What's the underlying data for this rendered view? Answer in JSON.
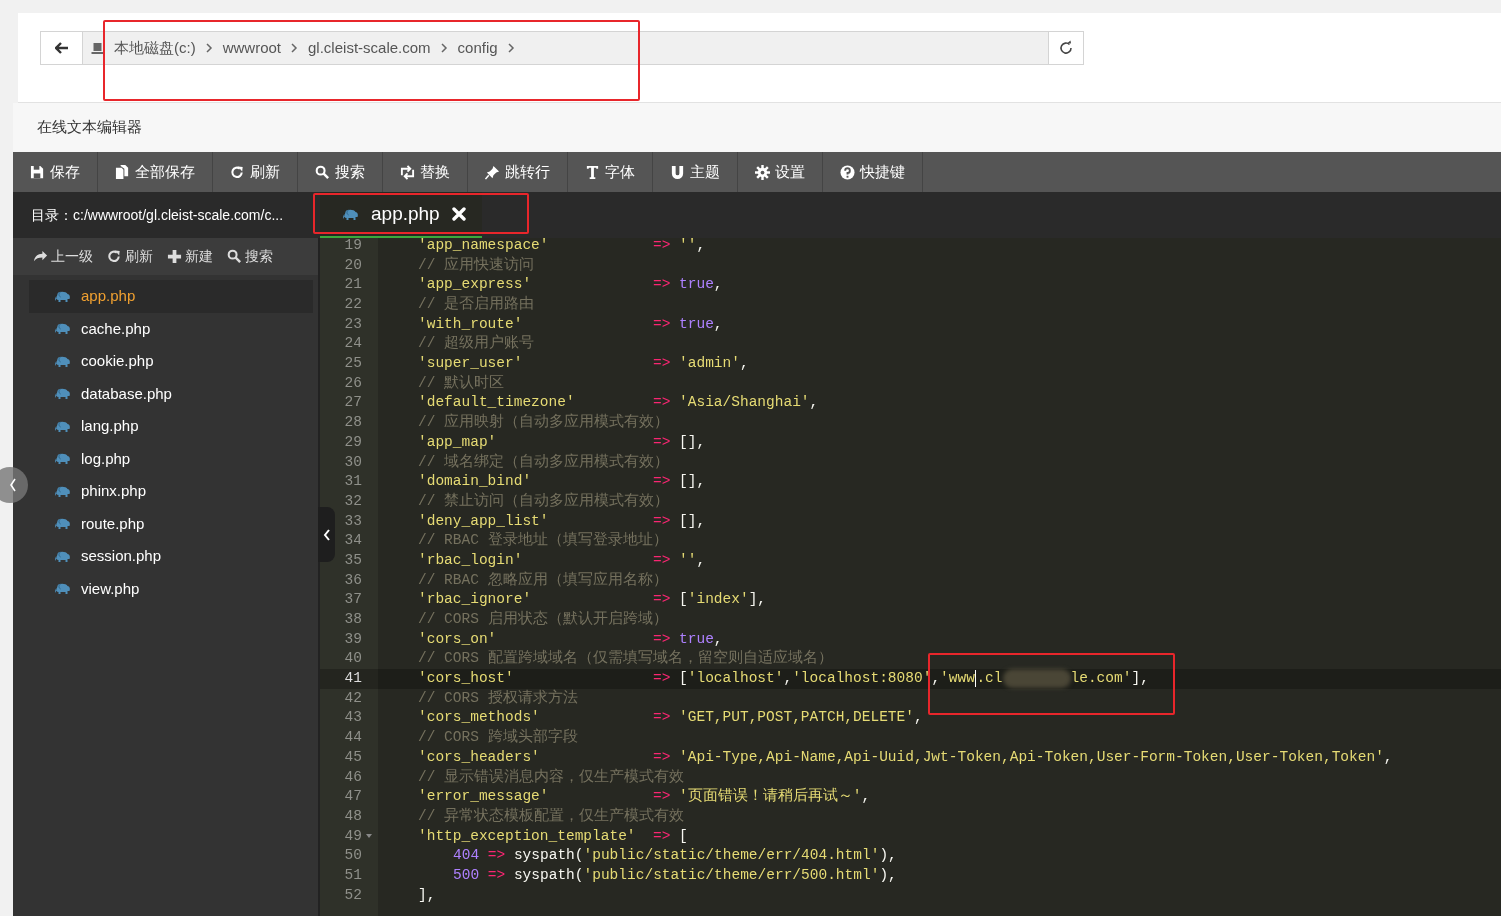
{
  "address_bar": {
    "crumbs": [
      "本地磁盘(c:)",
      "wwwroot",
      "gl.cleist-scale.com",
      "config"
    ]
  },
  "editor": {
    "title": "在线文本编辑器",
    "toolbar": [
      {
        "kind": "save",
        "label": "保存"
      },
      {
        "kind": "save-all",
        "label": "全部保存"
      },
      {
        "kind": "refresh",
        "label": "刷新"
      },
      {
        "kind": "search",
        "label": "搜索"
      },
      {
        "kind": "replace",
        "label": "替换"
      },
      {
        "kind": "goto",
        "label": "跳转行"
      },
      {
        "kind": "font",
        "label": "字体"
      },
      {
        "kind": "theme",
        "label": "主题"
      },
      {
        "kind": "settings",
        "label": "设置"
      },
      {
        "kind": "help",
        "label": "快捷键"
      }
    ],
    "directory": {
      "label": "目录：",
      "path": "c:/wwwroot/gl.cleist-scale.com/c..."
    },
    "tabs": [
      {
        "label": "app.php",
        "selected": true
      }
    ],
    "sidebar": {
      "toolbar": [
        {
          "kind": "up",
          "label": "上一级"
        },
        {
          "kind": "refresh",
          "label": "刷新"
        },
        {
          "kind": "new",
          "label": "新建"
        },
        {
          "kind": "search",
          "label": "搜索"
        }
      ],
      "files": [
        {
          "name": "app.php",
          "selected": true
        },
        {
          "name": "cache.php",
          "selected": false
        },
        {
          "name": "cookie.php",
          "selected": false
        },
        {
          "name": "database.php",
          "selected": false
        },
        {
          "name": "lang.php",
          "selected": false
        },
        {
          "name": "log.php",
          "selected": false
        },
        {
          "name": "phinx.php",
          "selected": false
        },
        {
          "name": "route.php",
          "selected": false
        },
        {
          "name": "session.php",
          "selected": false
        },
        {
          "name": "view.php",
          "selected": false
        }
      ]
    },
    "code": {
      "lines": [
        {
          "number": "19",
          "tokens": [
            {
              "kind": "key",
              "text": "'app_namespace'"
            },
            {
              "kind": "op",
              "text": "=>"
            },
            {
              "kind": "str",
              "text": "''"
            },
            {
              "kind": "punct",
              "text": ","
            }
          ]
        },
        {
          "number": "20",
          "tokens": [
            {
              "kind": "comment",
              "text": "// 应用快速访问"
            }
          ]
        },
        {
          "number": "21",
          "tokens": [
            {
              "kind": "key",
              "text": "'app_express'"
            },
            {
              "kind": "op",
              "text": "=>"
            },
            {
              "kind": "bool",
              "text": "true"
            },
            {
              "kind": "punct",
              "text": ","
            }
          ]
        },
        {
          "number": "22",
          "tokens": [
            {
              "kind": "comment",
              "text": "// 是否启用路由"
            }
          ]
        },
        {
          "number": "23",
          "tokens": [
            {
              "kind": "key",
              "text": "'with_route'"
            },
            {
              "kind": "op",
              "text": "=>"
            },
            {
              "kind": "bool",
              "text": "true"
            },
            {
              "kind": "punct",
              "text": ","
            }
          ]
        },
        {
          "number": "24",
          "tokens": [
            {
              "kind": "comment",
              "text": "// 超级用户账号"
            }
          ]
        },
        {
          "number": "25",
          "tokens": [
            {
              "kind": "key",
              "text": "'super_user'"
            },
            {
              "kind": "op",
              "text": "=>"
            },
            {
              "kind": "str",
              "text": "'admin'"
            },
            {
              "kind": "punct",
              "text": ","
            }
          ]
        },
        {
          "number": "26",
          "tokens": [
            {
              "kind": "comment",
              "text": "// 默认时区"
            }
          ]
        },
        {
          "number": "27",
          "tokens": [
            {
              "kind": "key",
              "text": "'default_timezone'"
            },
            {
              "kind": "op",
              "text": "=>"
            },
            {
              "kind": "str",
              "text": "'Asia/Shanghai'"
            },
            {
              "kind": "punct",
              "text": ","
            }
          ]
        },
        {
          "number": "28",
          "tokens": [
            {
              "kind": "comment",
              "text": "// 应用映射（自动多应用模式有效）"
            }
          ]
        },
        {
          "number": "29",
          "tokens": [
            {
              "kind": "key",
              "text": "'app_map'"
            },
            {
              "kind": "op",
              "text": "=>"
            },
            {
              "kind": "punct",
              "text": "[],"
            }
          ]
        },
        {
          "number": "30",
          "tokens": [
            {
              "kind": "comment",
              "text": "// 域名绑定（自动多应用模式有效）"
            }
          ]
        },
        {
          "number": "31",
          "tokens": [
            {
              "kind": "key",
              "text": "'domain_bind'"
            },
            {
              "kind": "op",
              "text": "=>"
            },
            {
              "kind": "punct",
              "text": "[],"
            }
          ]
        },
        {
          "number": "32",
          "tokens": [
            {
              "kind": "comment",
              "text": "// 禁止访问（自动多应用模式有效）"
            }
          ]
        },
        {
          "number": "33",
          "tokens": [
            {
              "kind": "key",
              "text": "'deny_app_list'"
            },
            {
              "kind": "op",
              "text": "=>"
            },
            {
              "kind": "punct",
              "text": "[],"
            }
          ]
        },
        {
          "number": "34",
          "tokens": [
            {
              "kind": "comment",
              "text": "// RBAC 登录地址（填写登录地址）"
            }
          ]
        },
        {
          "number": "35",
          "tokens": [
            {
              "kind": "key",
              "text": "'rbac_login'"
            },
            {
              "kind": "op",
              "text": "=>"
            },
            {
              "kind": "str",
              "text": "''"
            },
            {
              "kind": "punct",
              "text": ","
            }
          ]
        },
        {
          "number": "36",
          "tokens": [
            {
              "kind": "comment",
              "text": "// RBAC 忽略应用（填写应用名称）"
            }
          ]
        },
        {
          "number": "37",
          "tokens": [
            {
              "kind": "key",
              "text": "'rbac_ignore'"
            },
            {
              "kind": "op",
              "text": "=>"
            },
            {
              "kind": "punct",
              "text": "["
            },
            {
              "kind": "str",
              "text": "'index'"
            },
            {
              "kind": "punct",
              "text": "],"
            }
          ]
        },
        {
          "number": "38",
          "tokens": [
            {
              "kind": "comment",
              "text": "// CORS 启用状态（默认开启跨域）"
            }
          ]
        },
        {
          "number": "39",
          "tokens": [
            {
              "kind": "key",
              "text": "'cors_on'"
            },
            {
              "kind": "op",
              "text": "=>"
            },
            {
              "kind": "bool",
              "text": "true"
            },
            {
              "kind": "punct",
              "text": ","
            }
          ]
        },
        {
          "number": "40",
          "tokens": [
            {
              "kind": "comment",
              "text": "// CORS 配置跨域域名（仅需填写域名，留空则自适应域名）"
            }
          ]
        },
        {
          "number": "41",
          "active": true,
          "tokens": [
            {
              "kind": "key",
              "text": "'cors_host'"
            },
            {
              "kind": "op",
              "text": "=>"
            },
            {
              "kind": "punct",
              "text": "["
            },
            {
              "kind": "str",
              "text": "'localhost'"
            },
            {
              "kind": "punct",
              "text": ","
            },
            {
              "kind": "str",
              "text": "'localhost:8080'"
            },
            {
              "kind": "punct",
              "text": ","
            },
            {
              "kind": "str",
              "text": "'www"
            },
            {
              "kind": "cursor"
            },
            {
              "kind": "str",
              "text": ".cl"
            },
            {
              "kind": "blur"
            },
            {
              "kind": "str",
              "text": "le.com'"
            },
            {
              "kind": "punct",
              "text": "],"
            }
          ]
        },
        {
          "number": "42",
          "tokens": [
            {
              "kind": "comment",
              "text": "// CORS 授权请求方法"
            }
          ]
        },
        {
          "number": "43",
          "tokens": [
            {
              "kind": "key",
              "text": "'cors_methods'"
            },
            {
              "kind": "op",
              "text": "=>"
            },
            {
              "kind": "str",
              "text": "'GET,PUT,POST,PATCH,DELETE'"
            },
            {
              "kind": "punct",
              "text": ","
            }
          ]
        },
        {
          "number": "44",
          "tokens": [
            {
              "kind": "comment",
              "text": "// CORS 跨域头部字段"
            }
          ]
        },
        {
          "number": "45",
          "tokens": [
            {
              "kind": "key",
              "text": "'cors_headers'"
            },
            {
              "kind": "op",
              "text": "=>"
            },
            {
              "kind": "str",
              "text": "'Api-Type,Api-Name,Api-Uuid,Jwt-Token,Api-Token,User-Form-Token,User-Token,Token'"
            },
            {
              "kind": "punct",
              "text": ","
            }
          ]
        },
        {
          "number": "46",
          "tokens": [
            {
              "kind": "comment",
              "text": "// 显示错误消息内容，仅生产模式有效"
            }
          ]
        },
        {
          "number": "47",
          "tokens": [
            {
              "kind": "key",
              "text": "'error_message'"
            },
            {
              "kind": "op",
              "text": "=>"
            },
            {
              "kind": "str",
              "text": "'页面错误！请稍后再试～'"
            },
            {
              "kind": "punct",
              "text": ","
            }
          ]
        },
        {
          "number": "48",
          "tokens": [
            {
              "kind": "comment",
              "text": "// 异常状态模板配置，仅生产模式有效"
            }
          ]
        },
        {
          "number": "49",
          "expanded": true,
          "tokens": [
            {
              "kind": "key",
              "text": "'http_exception_template'"
            },
            {
              "kind": "op",
              "text": "=>"
            },
            {
              "kind": "punct",
              "text": "["
            }
          ],
          "children": [
            {
              "number": "50",
              "tokens": [
                {
                  "kind": "num",
                  "text": "404"
                },
                {
                  "kind": "op",
                  "text": "=>"
                },
                {
                  "kind": "plain",
                  "text": "syspath("
                },
                {
                  "kind": "str",
                  "text": "'public/static/theme/err/404.html'"
                },
                {
                  "kind": "plain",
                  "text": "),"
                }
              ]
            },
            {
              "number": "51",
              "tokens": [
                {
                  "kind": "num",
                  "text": "500"
                },
                {
                  "kind": "op",
                  "text": "=>"
                },
                {
                  "kind": "plain",
                  "text": "syspath("
                },
                {
                  "kind": "str",
                  "text": "'public/static/theme/err/500.html'"
                },
                {
                  "kind": "plain",
                  "text": "),"
                }
              ]
            }
          ]
        },
        {
          "number": "52",
          "tokens": [
            {
              "kind": "punct",
              "text": "],"
            }
          ]
        }
      ]
    }
  }
}
